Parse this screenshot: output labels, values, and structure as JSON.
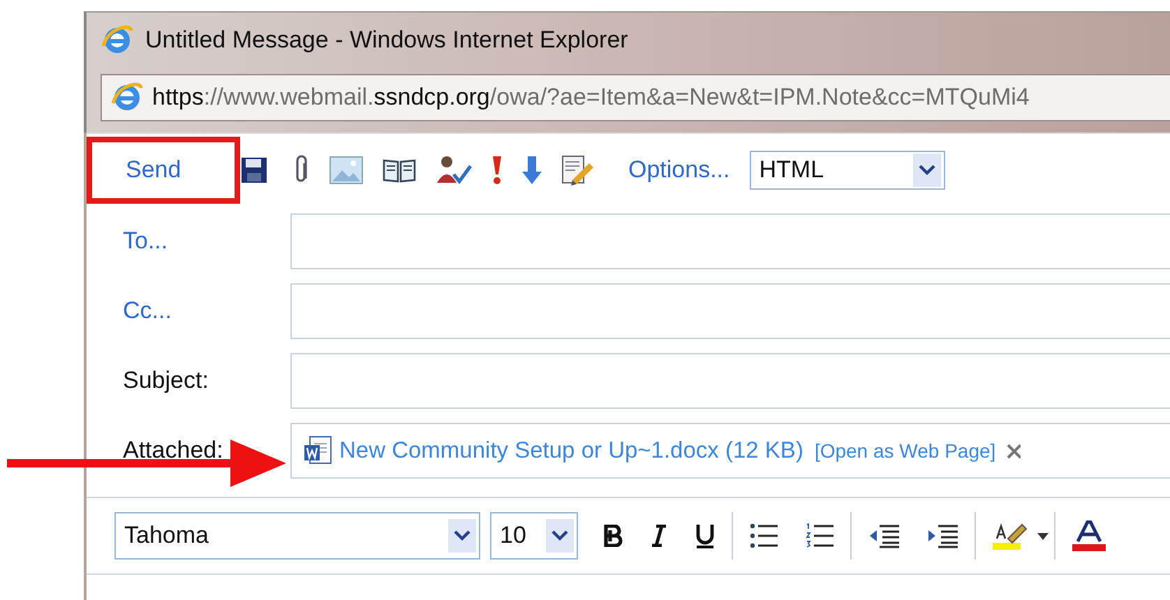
{
  "window": {
    "title": "Untitled Message - Windows Internet Explorer"
  },
  "address_bar": {
    "url": "**https**://www.webmail.**ssndcp.org**/owa/?ae=Item&a=New&t=IPM.Note&cc=MTQuMi4"
  },
  "toolbar": {
    "send": {
      "label": "Send",
      "highlighted": true
    },
    "options": "Options...",
    "format": "HTML"
  },
  "fields": [
    {
      "kind": "button",
      "label": "To..."
    },
    {
      "kind": "button",
      "label": "Cc..."
    },
    {
      "kind": "plain",
      "label": "Subject:"
    }
  ],
  "attachment": {
    "label": "Attached:",
    "file": "New Community Setup or Up~1.docx (12 KB)",
    "action": "[Open as Web Page]",
    "pointed": true
  },
  "editor_toolbar": {
    "font": "Tahoma",
    "size": "10"
  }
}
